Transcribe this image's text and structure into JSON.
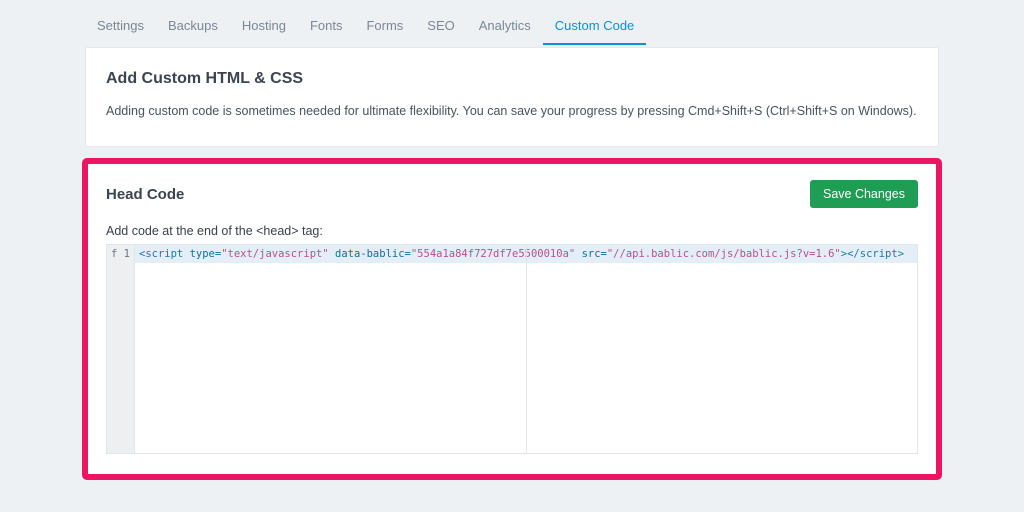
{
  "tabs": {
    "items": [
      "Settings",
      "Backups",
      "Hosting",
      "Fonts",
      "Forms",
      "SEO",
      "Analytics",
      "Custom Code"
    ],
    "active_index": 7
  },
  "intro": {
    "title": "Add Custom HTML & CSS",
    "description": "Adding custom code is sometimes needed for ultimate flexibility. You can save your progress by pressing Cmd+Shift+S (Ctrl+Shift+S on Windows)."
  },
  "head_code": {
    "title": "Head Code",
    "save_label": "Save Changes",
    "instruction": "Add code at the end of the <head> tag:",
    "line_number": "1",
    "fold_symbol": "f",
    "code_tokens": {
      "open_bracket": "<",
      "tag1": "script",
      "sp": " ",
      "attr1": "type=",
      "str1": "\"text/javascript\"",
      "attr2": "data-bablic=",
      "str2": "\"554a1a84f727df7e5500010a\"",
      "attr3": "src=",
      "str3": "\"//api.bablic.com/js/bablic.js?v=1.6\"",
      "close_bracket1": ">",
      "open_bracket2": "</",
      "tag2": "script",
      "close_bracket2": ">"
    }
  }
}
